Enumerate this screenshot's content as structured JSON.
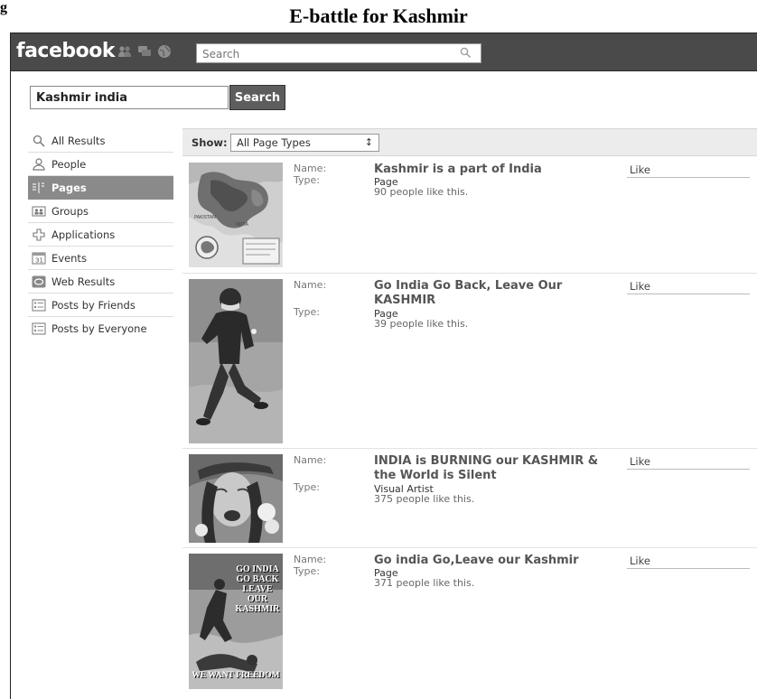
{
  "figure": {
    "label": "g",
    "title": "E-battle for Kashmir"
  },
  "topbar": {
    "logo": "facebook",
    "jewels": [
      "friend-requests-icon",
      "messages-icon",
      "notifications-icon"
    ],
    "search_placeholder": "Search"
  },
  "query": {
    "value": "Kashmir india",
    "button": "Search"
  },
  "nav": {
    "items": [
      {
        "label": "All Results",
        "icon": "magnifier-icon"
      },
      {
        "label": "People",
        "icon": "person-icon"
      },
      {
        "label": "Pages",
        "icon": "pages-icon",
        "active": true
      },
      {
        "label": "Groups",
        "icon": "groups-icon"
      },
      {
        "label": "Applications",
        "icon": "applications-icon"
      },
      {
        "label": "Events",
        "icon": "calendar-icon"
      },
      {
        "label": "Web Results",
        "icon": "web-icon"
      },
      {
        "label": "Posts by Friends",
        "icon": "posts-icon"
      },
      {
        "label": "Posts by Everyone",
        "icon": "posts-icon"
      }
    ]
  },
  "filter": {
    "label": "Show:",
    "selected": "All Page Types"
  },
  "labels": {
    "name": "Name:",
    "type": "Type:"
  },
  "results": [
    {
      "name": "Kashmir is a part of India",
      "type": "Page",
      "likes": "90 people like this.",
      "like": "Like"
    },
    {
      "name": "Go India Go Back, Leave Our KASHMIR",
      "type": "Page",
      "likes": "39 people like this.",
      "like": "Like"
    },
    {
      "name": "INDIA is BURNING our KASHMIR & the World is Silent",
      "type": "Visual Artist",
      "likes": "375 people like this.",
      "like": "Like"
    },
    {
      "name": "Go india Go,Leave our Kashmir",
      "type": "Page",
      "likes": "371 people like this.",
      "like": "Like"
    }
  ],
  "poster_text": {
    "top": "GO INDIA GO BACK LEAVE OUR KASHMIR",
    "bottom": "WE WANT FREEDOM"
  }
}
